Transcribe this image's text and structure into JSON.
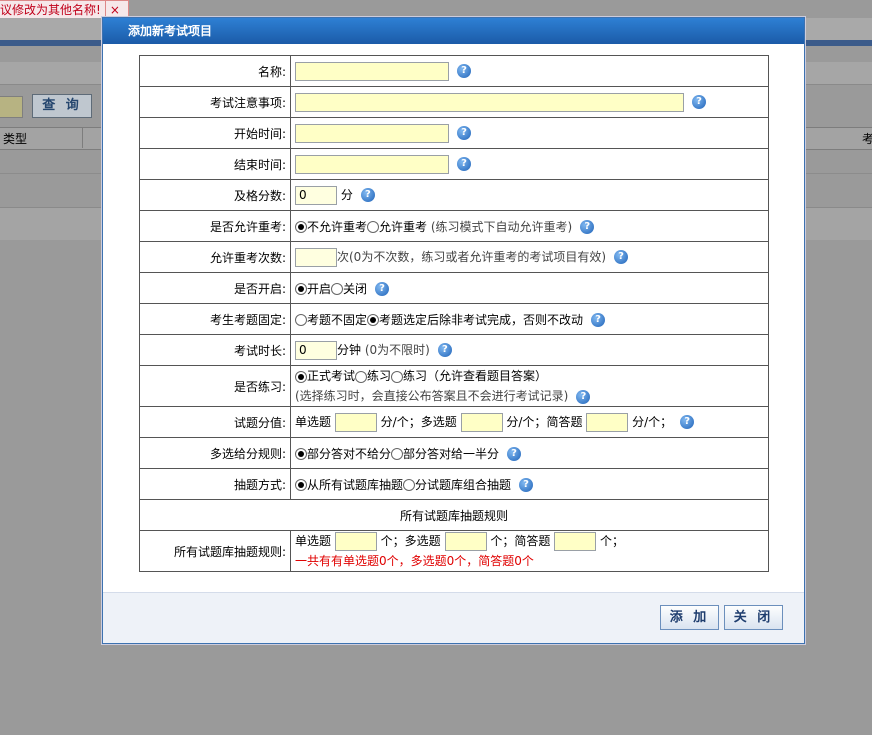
{
  "background": {
    "tab_text": "议修改为其他名称!",
    "tab_close": "×",
    "search_button": "查 询",
    "col_type": "类型",
    "col_right": "考"
  },
  "dialog": {
    "title": "添加新考试项目",
    "buttons": {
      "add": "添 加",
      "close": "关 闭"
    }
  },
  "form": {
    "name_label": "名称:",
    "notes_label": "考试注意事项:",
    "start_label": "开始时间:",
    "end_label": "结束时间:",
    "pass_label": "及格分数:",
    "pass_value": "0",
    "pass_unit": "分",
    "retake_label": "是否允许重考:",
    "retake_no": "不允许重考",
    "retake_yes": "允许重考",
    "retake_hint": "(练习模式下自动允许重考)",
    "retake_count_label": "允许重考次数:",
    "retake_count_value": "",
    "retake_count_hint": "次(0为不次数，练习或者允许重考的考试项目有效)",
    "open_label": "是否开启:",
    "open_yes": "开启",
    "open_no": "关闭",
    "fixed_label": "考生考题固定:",
    "fixed_no": "考题不固定",
    "fixed_yes": "考题选定后除非考试完成，否则不改动",
    "duration_label": "考试时长:",
    "duration_value": "0",
    "duration_unit": "分钟",
    "duration_hint": "(0为不限时)",
    "practice_label": "是否练习:",
    "practice_formal": "正式考试",
    "practice_practice": "练习",
    "practice_view": "练习（允许查看题目答案）",
    "practice_hint": "(选择练习时，会直接公布答案且不会进行考试记录)",
    "score_label": "试题分值:",
    "score_single": "单选题",
    "score_unit1": "分/个；",
    "score_multi": "多选题",
    "score_unit2": "分/个；",
    "score_essay": "简答题",
    "score_unit3": "分/个；",
    "multi_rule_label": "多选给分规则:",
    "multi_rule_a": "部分答对不给分",
    "multi_rule_b": "部分答对给一半分",
    "draw_label": "抽题方式:",
    "draw_all": "从所有试题库抽题",
    "draw_group": "分试题库组合抽题",
    "section_title": "所有试题库抽题规则",
    "rule_label": "所有试题库抽题规则:",
    "rule_single": "单选题",
    "rule_unit1": "个；多选题",
    "rule_unit2": "个；简答题",
    "rule_unit3": "个；",
    "rule_summary": "一共有有单选题0个，多选题0个，简答题0个"
  },
  "colors": {
    "accent": "#1b5ba8",
    "input_bg": "#ffffc6",
    "warning": "#e00000"
  },
  "icons": {
    "help": "help-icon"
  }
}
